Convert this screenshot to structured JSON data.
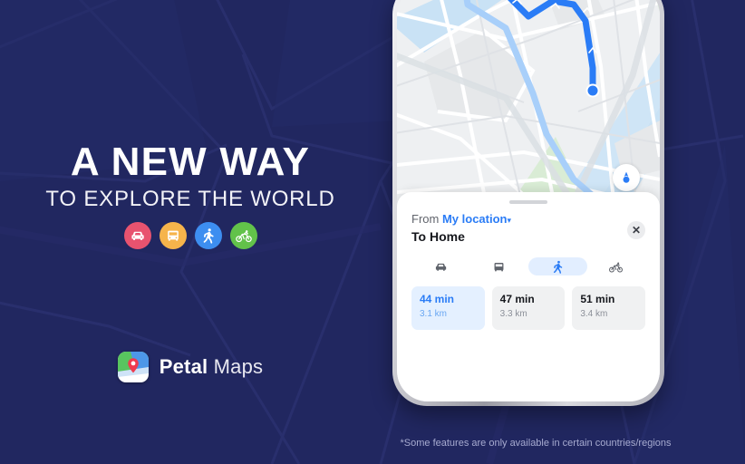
{
  "background": {
    "color": "#212760"
  },
  "promo": {
    "headline": "A NEW WAY",
    "subhead": "TO EXPLORE THE WORLD",
    "mode_icons": [
      {
        "name": "car-icon",
        "label": "Car",
        "color": "#e8536f"
      },
      {
        "name": "bus-icon",
        "label": "Bus",
        "color": "#f5b councils"
      },
      {
        "name": "walk-icon",
        "label": "Walk",
        "color": "#3d8ef0"
      },
      {
        "name": "bike-icon",
        "label": "Bicycle",
        "color": "#62c24a"
      }
    ],
    "brand": {
      "bold": "Petal",
      "light": "Maps",
      "logo_name": "petal-maps-logo"
    }
  },
  "footnote": "*Some features are only available in certain countries/regions",
  "phone": {
    "map": {
      "location_button": "my-location-button",
      "route_color": "#2a7cf6"
    },
    "sheet": {
      "from_label": "From",
      "from_value": "My location",
      "from_caret": "▾",
      "to_text": "To Home",
      "close_label": "✕",
      "tabs": [
        {
          "name": "tab-car",
          "label": "Car",
          "active": false
        },
        {
          "name": "tab-bus",
          "label": "Bus",
          "active": false
        },
        {
          "name": "tab-walk",
          "label": "Walking",
          "active": true
        },
        {
          "name": "tab-bike",
          "label": "Cycling",
          "active": false
        }
      ],
      "routes": [
        {
          "time": "44 min",
          "distance": "3.1 km",
          "active": true
        },
        {
          "time": "47 min",
          "distance": "3.3 km",
          "active": false
        },
        {
          "time": "51 min",
          "distance": "3.4 km",
          "active": false
        }
      ]
    }
  }
}
